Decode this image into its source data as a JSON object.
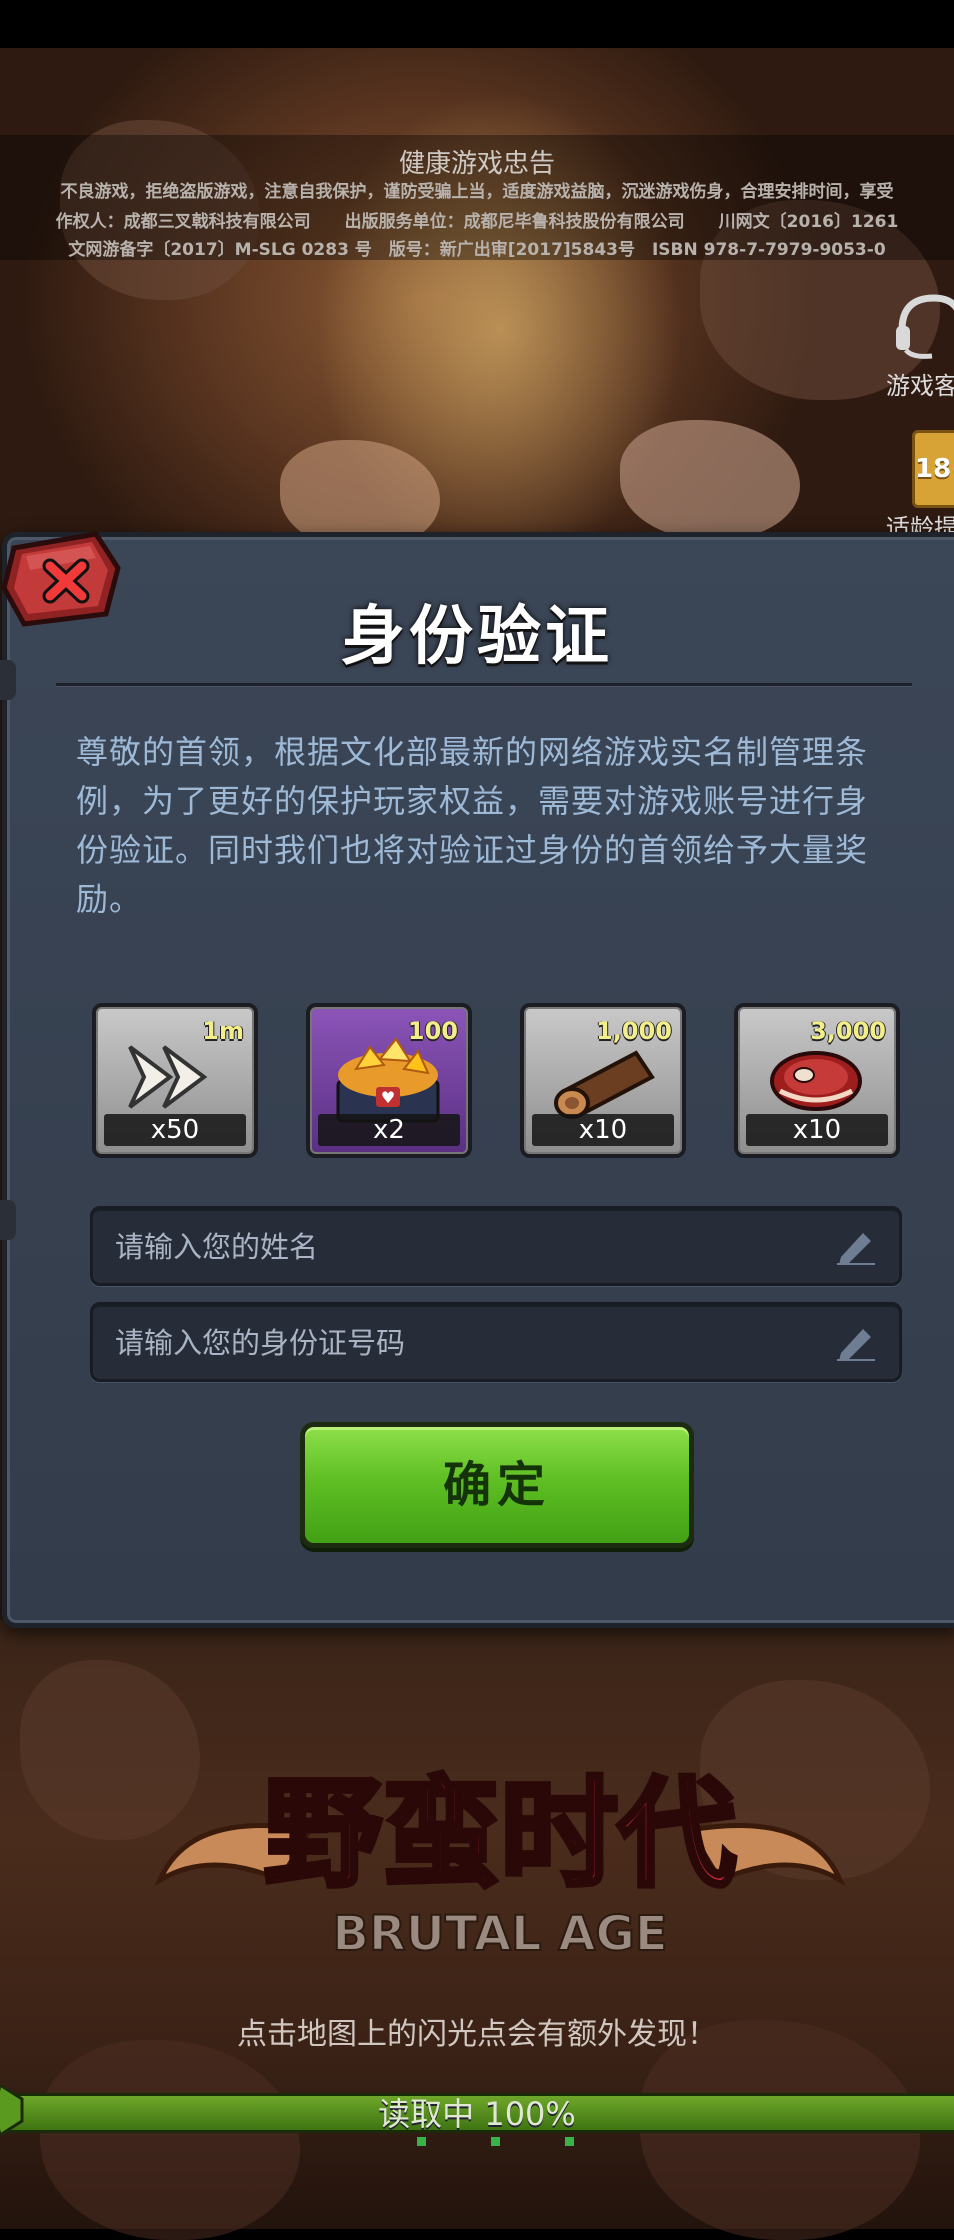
{
  "notice": {
    "title": "健康游戏忠告",
    "line1": "不良游戏，拒绝盗版游戏，注意自我保护，谨防受骗上当，适度游戏益脑，沉迷游戏伤身，合理安排时间，享受",
    "line2": "作权人：成都三叉戟科技有限公司　　出版服务单位：成都尼毕鲁科技股份有限公司　　川网文〔2016〕1261",
    "line3": "文网游备字〔2017〕M-SLG 0283 号　版号：新广出审[2017]5843号　ISBN 978-7-7979-9053-0"
  },
  "side": {
    "service_label": "游戏客",
    "age_badge": "18+",
    "age_label": "适龄提"
  },
  "dialog": {
    "title": "身份验证",
    "description": "尊敬的首领，根据文化部最新的网络游戏实名制管理条例，为了更好的保护玩家权益，需要对游戏账号进行身份验证。同时我们也将对验证过身份的首领给予大量奖励。",
    "rewards": [
      {
        "icon": "speedup-arrow-icon",
        "badge": "1m",
        "qty": "x50"
      },
      {
        "icon": "gem-chest-icon",
        "badge": "100",
        "qty": "x2"
      },
      {
        "icon": "wood-log-icon",
        "badge": "1,000",
        "qty": "x10"
      },
      {
        "icon": "meat-icon",
        "badge": "3,000",
        "qty": "x10"
      }
    ],
    "name_placeholder": "请输入您的姓名",
    "id_placeholder": "请输入您的身份证号码",
    "confirm_label": "确定"
  },
  "logo": {
    "cn": "野蛮时代",
    "en": "BRUTAL AGE"
  },
  "tip": "点击地图上的闪光点会有额外发现！",
  "loading": {
    "text": "读取中 100%",
    "progress": 1.0
  },
  "colors": {
    "dialog_bg": "#3b4657",
    "description": "#9db9d6",
    "confirm_green": "#5fbf24",
    "close_red": "#c23a3a"
  }
}
